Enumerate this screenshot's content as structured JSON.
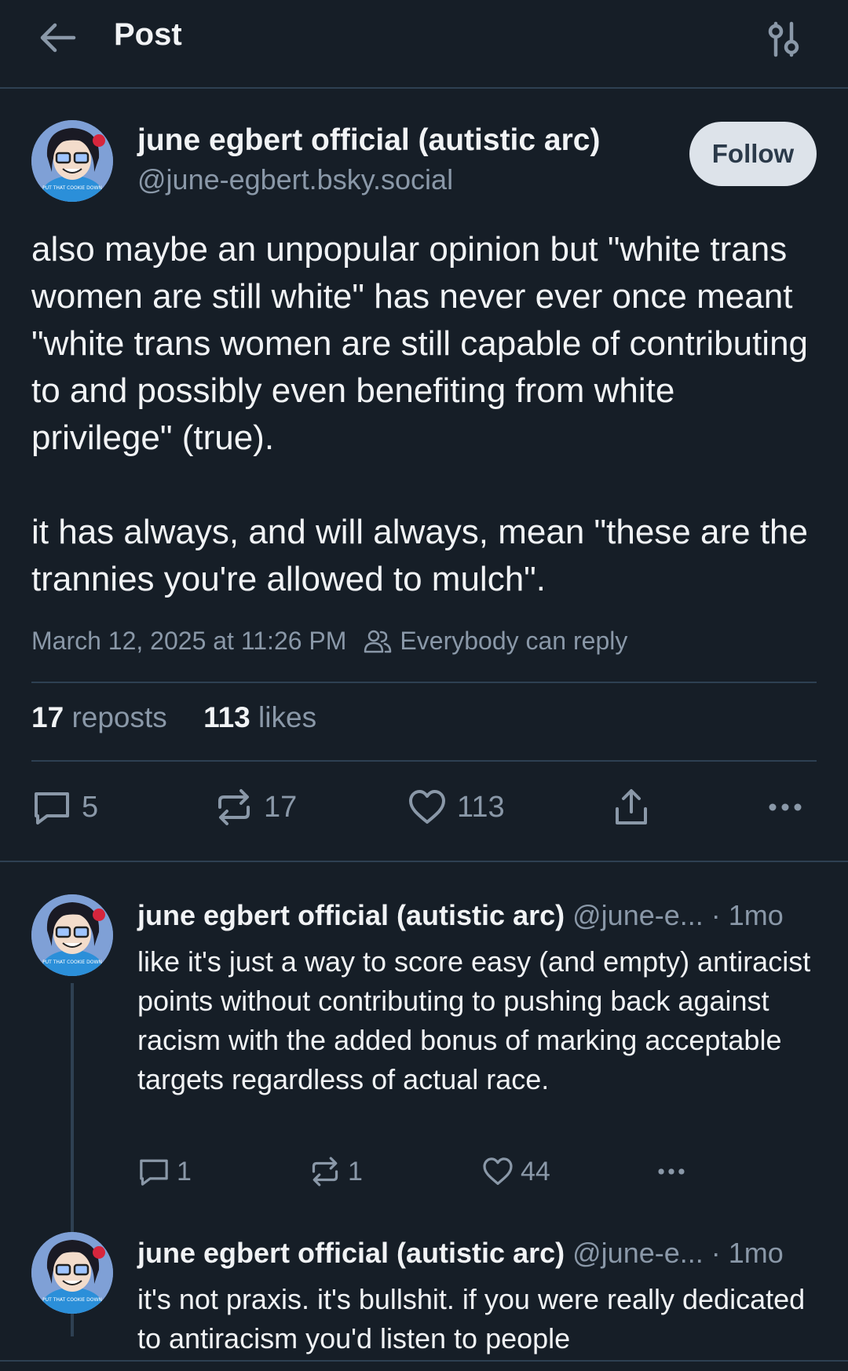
{
  "header": {
    "title": "Post"
  },
  "post": {
    "author_name": "june egbert official (autistic arc)",
    "author_handle": "@june-egbert.bsky.social",
    "follow_label": "Follow",
    "avatar_caption": "PUT THAT COOKIE DOWN",
    "paragraphs": [
      "also maybe an unpopular opinion but \"white trans women are still white\" has never ever once meant \"white trans women are still capable of contributing to and possibly even benefiting from white privilege\" (true).",
      "it has always, and will always, mean \"these are the trannies you're allowed to mulch\"."
    ],
    "timestamp": "March 12, 2025 at 11:26 PM",
    "reply_setting": "Everybody can reply",
    "reposts_count": "17",
    "reposts_label": "reposts",
    "likes_count": "113",
    "likes_label": "likes",
    "actions": {
      "replies": "5",
      "reposts": "17",
      "likes": "113"
    }
  },
  "replies": [
    {
      "author_name": "june egbert official (autistic arc)",
      "handle": "@june-e...",
      "time": "· 1mo",
      "text": "like it's just a way to score easy (and empty) antiracist points without contributing to pushing back against racism with the added bonus of marking acceptable targets regardless of actual race.",
      "replies": "1",
      "reposts": "1",
      "likes": "44"
    },
    {
      "author_name": "june egbert official (autistic arc)",
      "handle": "@june-e...",
      "time": "· 1mo",
      "text": "it's not praxis. it's bullshit. if you were really dedicated to antiracism you'd listen to people"
    }
  ],
  "colors": {
    "background": "#161e27",
    "divider": "#2e4052",
    "muted_text": "#8a98a8",
    "follow_button": "#dde3ea"
  }
}
